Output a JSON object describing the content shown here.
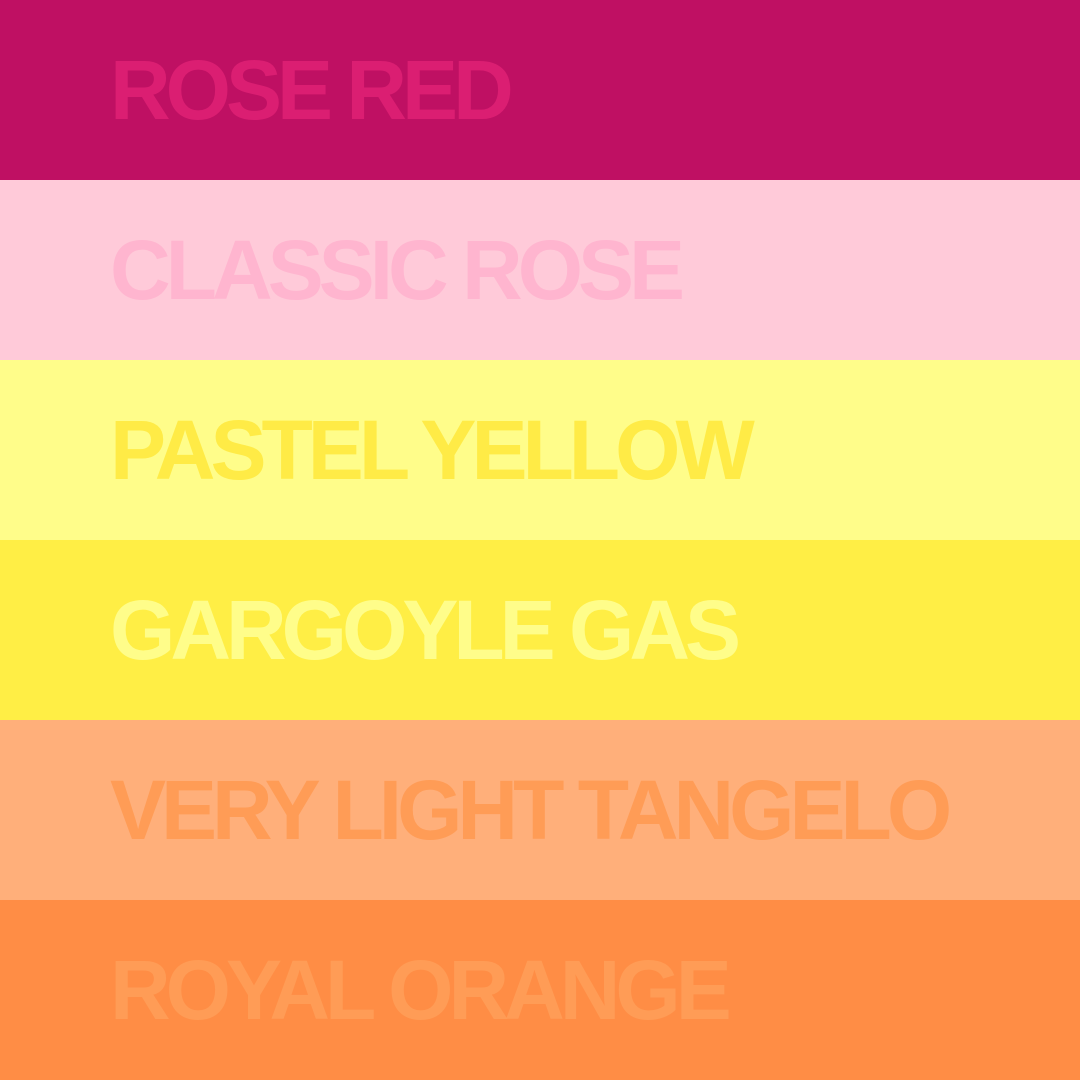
{
  "palette": {
    "swatches": [
      {
        "name": "ROSE RED",
        "color": "#BF1063",
        "label_color": "#DB1E72"
      },
      {
        "name": "CLASSIC ROSE",
        "color": "#FFCAD9",
        "label_color": "#FFB5CF"
      },
      {
        "name": "PASTEL YELLOW",
        "color": "#FFFD8A",
        "label_color": "#FFEB46"
      },
      {
        "name": "GARGOYLE GAS",
        "color": "#FFEE45",
        "label_color": "#FFFD8A"
      },
      {
        "name": "VERY LIGHT TANGELO",
        "color": "#FFAF7A",
        "label_color": "#FF9C56"
      },
      {
        "name": "ROYAL ORANGE",
        "color": "#FF8D45",
        "label_color": "#FF9C56"
      }
    ]
  }
}
